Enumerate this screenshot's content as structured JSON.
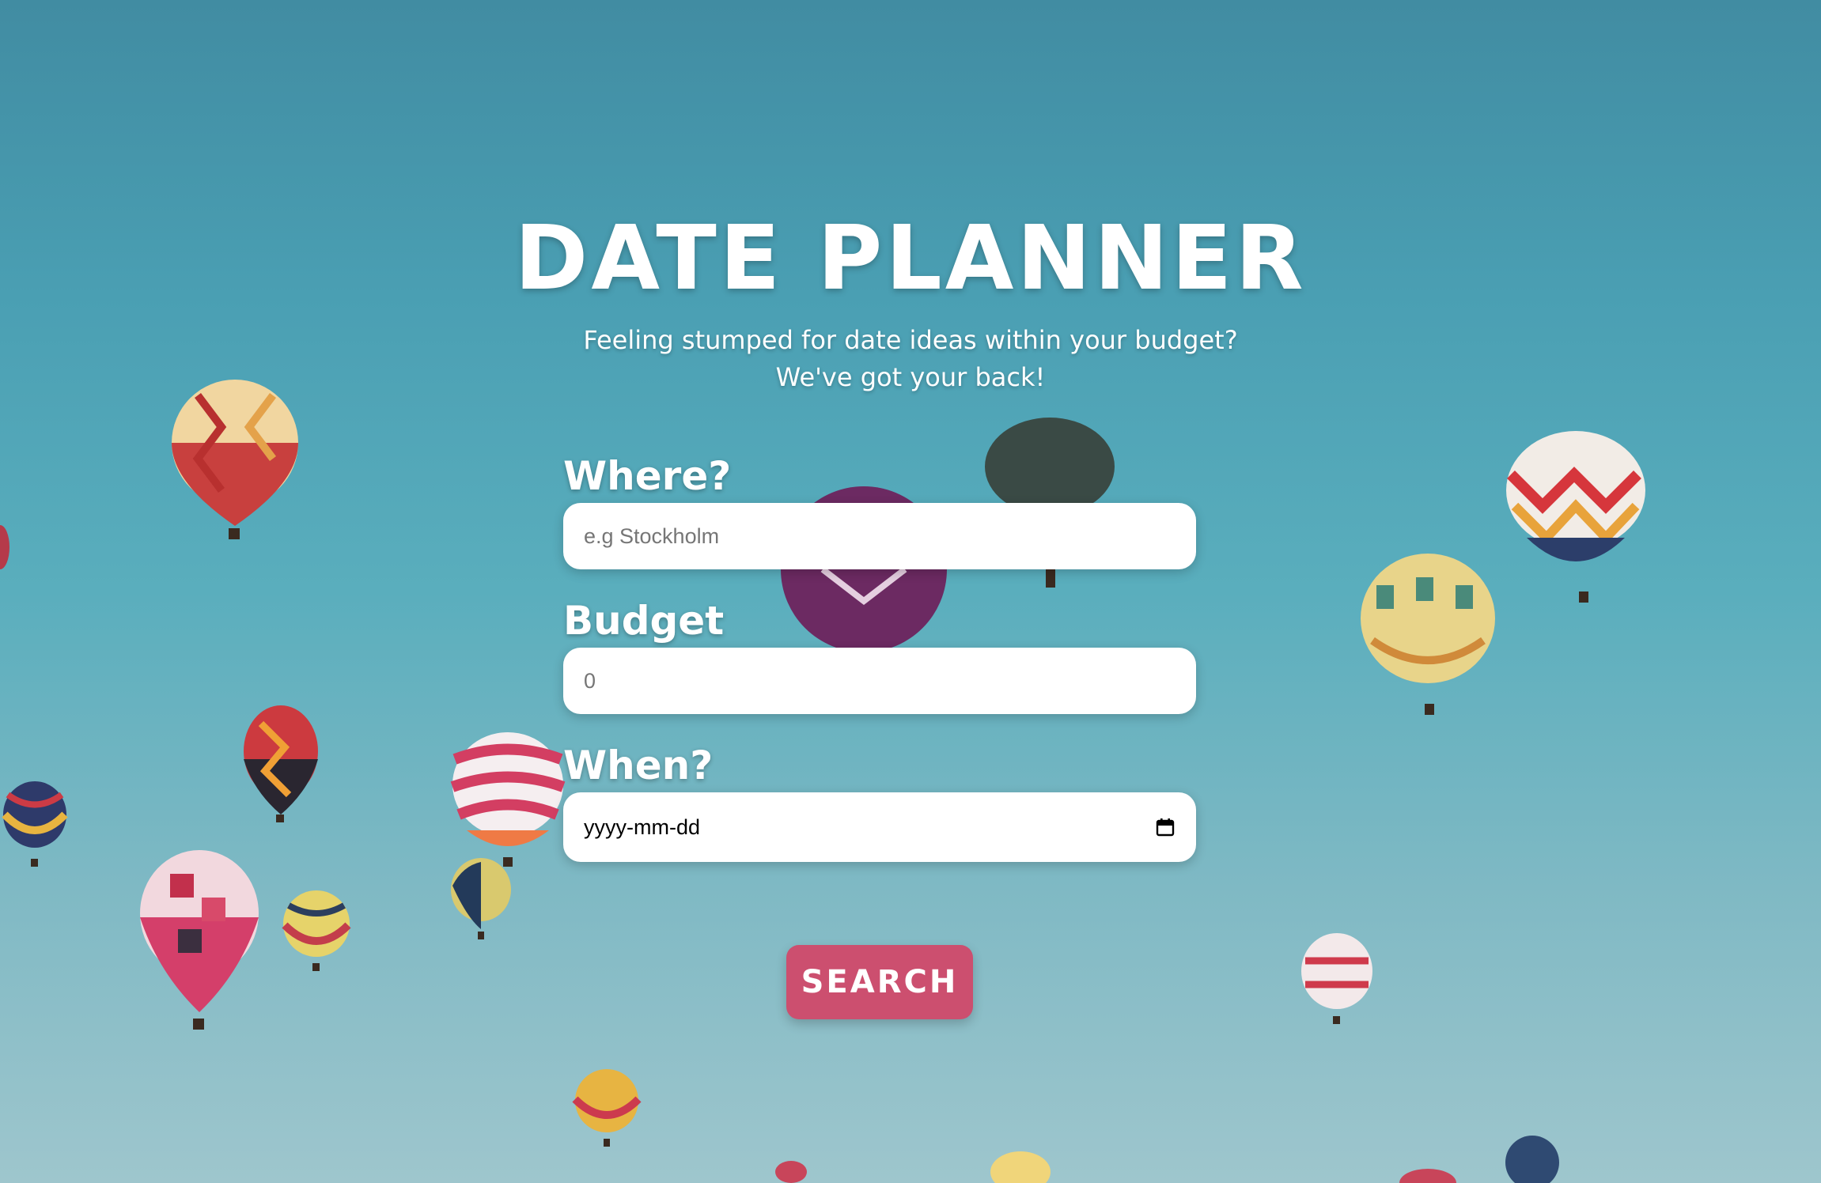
{
  "app": {
    "title": "DATE PLANNER",
    "subtitle_line1": "Feeling stumped for date ideas within your budget?",
    "subtitle_line2": "We've got your back!"
  },
  "form": {
    "where": {
      "label": "Where?",
      "placeholder": "e.g Stockholm",
      "value": ""
    },
    "budget": {
      "label": "Budget",
      "placeholder": "0",
      "value": ""
    },
    "when": {
      "label": "When?",
      "value_display": "yyyy-mm-dd",
      "icon": "calendar-icon"
    },
    "search_label": "SEARCH"
  },
  "colors": {
    "sky_top": "#418ca2",
    "sky_bottom": "#9ec6cd",
    "button": "#cc4f6f",
    "field_bg": "#ffffff",
    "text": "#ffffff"
  }
}
